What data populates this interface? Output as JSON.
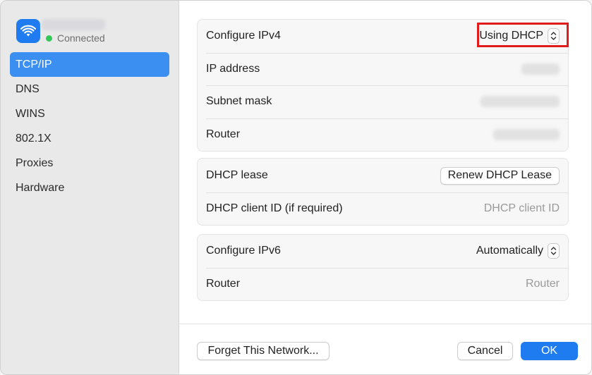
{
  "network": {
    "status": "Connected",
    "icon": "wifi-icon"
  },
  "sidebar": {
    "items": [
      {
        "label": "TCP/IP",
        "active": true
      },
      {
        "label": "DNS"
      },
      {
        "label": "WINS"
      },
      {
        "label": "802.1X"
      },
      {
        "label": "Proxies"
      },
      {
        "label": "Hardware"
      }
    ]
  },
  "ipv4": {
    "configure_label": "Configure IPv4",
    "configure_value": "Using DHCP",
    "ip_label": "IP address",
    "subnet_label": "Subnet mask",
    "router_label": "Router"
  },
  "dhcp": {
    "lease_label": "DHCP lease",
    "renew_button": "Renew DHCP Lease",
    "client_id_label": "DHCP client ID (if required)",
    "client_id_placeholder": "DHCP client ID"
  },
  "ipv6": {
    "configure_label": "Configure IPv6",
    "configure_value": "Automatically",
    "router_label": "Router",
    "router_placeholder": "Router"
  },
  "footer": {
    "forget_button": "Forget This Network...",
    "cancel_button": "Cancel",
    "ok_button": "OK"
  },
  "colors": {
    "accent": "#1e7cf0",
    "sidebar_active": "#3b8ff0",
    "status_connected": "#34c759",
    "highlight": "#e11a1a"
  }
}
